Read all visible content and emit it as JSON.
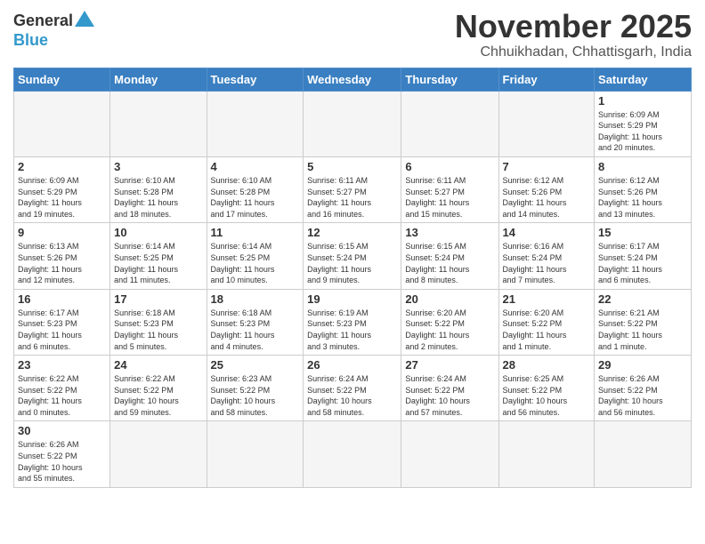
{
  "header": {
    "logo_general": "General",
    "logo_blue": "Blue",
    "month_title": "November 2025",
    "location": "Chhuikhadan, Chhattisgarh, India"
  },
  "weekdays": [
    "Sunday",
    "Monday",
    "Tuesday",
    "Wednesday",
    "Thursday",
    "Friday",
    "Saturday"
  ],
  "weeks": [
    [
      {
        "day": null,
        "info": null
      },
      {
        "day": null,
        "info": null
      },
      {
        "day": null,
        "info": null
      },
      {
        "day": null,
        "info": null
      },
      {
        "day": null,
        "info": null
      },
      {
        "day": null,
        "info": null
      },
      {
        "day": "1",
        "info": "Sunrise: 6:09 AM\nSunset: 5:29 PM\nDaylight: 11 hours\nand 20 minutes."
      }
    ],
    [
      {
        "day": "2",
        "info": "Sunrise: 6:09 AM\nSunset: 5:29 PM\nDaylight: 11 hours\nand 19 minutes."
      },
      {
        "day": "3",
        "info": "Sunrise: 6:10 AM\nSunset: 5:28 PM\nDaylight: 11 hours\nand 18 minutes."
      },
      {
        "day": "4",
        "info": "Sunrise: 6:10 AM\nSunset: 5:28 PM\nDaylight: 11 hours\nand 17 minutes."
      },
      {
        "day": "5",
        "info": "Sunrise: 6:11 AM\nSunset: 5:27 PM\nDaylight: 11 hours\nand 16 minutes."
      },
      {
        "day": "6",
        "info": "Sunrise: 6:11 AM\nSunset: 5:27 PM\nDaylight: 11 hours\nand 15 minutes."
      },
      {
        "day": "7",
        "info": "Sunrise: 6:12 AM\nSunset: 5:26 PM\nDaylight: 11 hours\nand 14 minutes."
      },
      {
        "day": "8",
        "info": "Sunrise: 6:12 AM\nSunset: 5:26 PM\nDaylight: 11 hours\nand 13 minutes."
      }
    ],
    [
      {
        "day": "9",
        "info": "Sunrise: 6:13 AM\nSunset: 5:26 PM\nDaylight: 11 hours\nand 12 minutes."
      },
      {
        "day": "10",
        "info": "Sunrise: 6:14 AM\nSunset: 5:25 PM\nDaylight: 11 hours\nand 11 minutes."
      },
      {
        "day": "11",
        "info": "Sunrise: 6:14 AM\nSunset: 5:25 PM\nDaylight: 11 hours\nand 10 minutes."
      },
      {
        "day": "12",
        "info": "Sunrise: 6:15 AM\nSunset: 5:24 PM\nDaylight: 11 hours\nand 9 minutes."
      },
      {
        "day": "13",
        "info": "Sunrise: 6:15 AM\nSunset: 5:24 PM\nDaylight: 11 hours\nand 8 minutes."
      },
      {
        "day": "14",
        "info": "Sunrise: 6:16 AM\nSunset: 5:24 PM\nDaylight: 11 hours\nand 7 minutes."
      },
      {
        "day": "15",
        "info": "Sunrise: 6:17 AM\nSunset: 5:24 PM\nDaylight: 11 hours\nand 6 minutes."
      }
    ],
    [
      {
        "day": "16",
        "info": "Sunrise: 6:17 AM\nSunset: 5:23 PM\nDaylight: 11 hours\nand 6 minutes."
      },
      {
        "day": "17",
        "info": "Sunrise: 6:18 AM\nSunset: 5:23 PM\nDaylight: 11 hours\nand 5 minutes."
      },
      {
        "day": "18",
        "info": "Sunrise: 6:18 AM\nSunset: 5:23 PM\nDaylight: 11 hours\nand 4 minutes."
      },
      {
        "day": "19",
        "info": "Sunrise: 6:19 AM\nSunset: 5:23 PM\nDaylight: 11 hours\nand 3 minutes."
      },
      {
        "day": "20",
        "info": "Sunrise: 6:20 AM\nSunset: 5:22 PM\nDaylight: 11 hours\nand 2 minutes."
      },
      {
        "day": "21",
        "info": "Sunrise: 6:20 AM\nSunset: 5:22 PM\nDaylight: 11 hours\nand 1 minute."
      },
      {
        "day": "22",
        "info": "Sunrise: 6:21 AM\nSunset: 5:22 PM\nDaylight: 11 hours\nand 1 minute."
      }
    ],
    [
      {
        "day": "23",
        "info": "Sunrise: 6:22 AM\nSunset: 5:22 PM\nDaylight: 11 hours\nand 0 minutes."
      },
      {
        "day": "24",
        "info": "Sunrise: 6:22 AM\nSunset: 5:22 PM\nDaylight: 10 hours\nand 59 minutes."
      },
      {
        "day": "25",
        "info": "Sunrise: 6:23 AM\nSunset: 5:22 PM\nDaylight: 10 hours\nand 58 minutes."
      },
      {
        "day": "26",
        "info": "Sunrise: 6:24 AM\nSunset: 5:22 PM\nDaylight: 10 hours\nand 58 minutes."
      },
      {
        "day": "27",
        "info": "Sunrise: 6:24 AM\nSunset: 5:22 PM\nDaylight: 10 hours\nand 57 minutes."
      },
      {
        "day": "28",
        "info": "Sunrise: 6:25 AM\nSunset: 5:22 PM\nDaylight: 10 hours\nand 56 minutes."
      },
      {
        "day": "29",
        "info": "Sunrise: 6:26 AM\nSunset: 5:22 PM\nDaylight: 10 hours\nand 56 minutes."
      }
    ],
    [
      {
        "day": "30",
        "info": "Sunrise: 6:26 AM\nSunset: 5:22 PM\nDaylight: 10 hours\nand 55 minutes."
      },
      {
        "day": null,
        "info": null
      },
      {
        "day": null,
        "info": null
      },
      {
        "day": null,
        "info": null
      },
      {
        "day": null,
        "info": null
      },
      {
        "day": null,
        "info": null
      },
      {
        "day": null,
        "info": null
      }
    ]
  ]
}
